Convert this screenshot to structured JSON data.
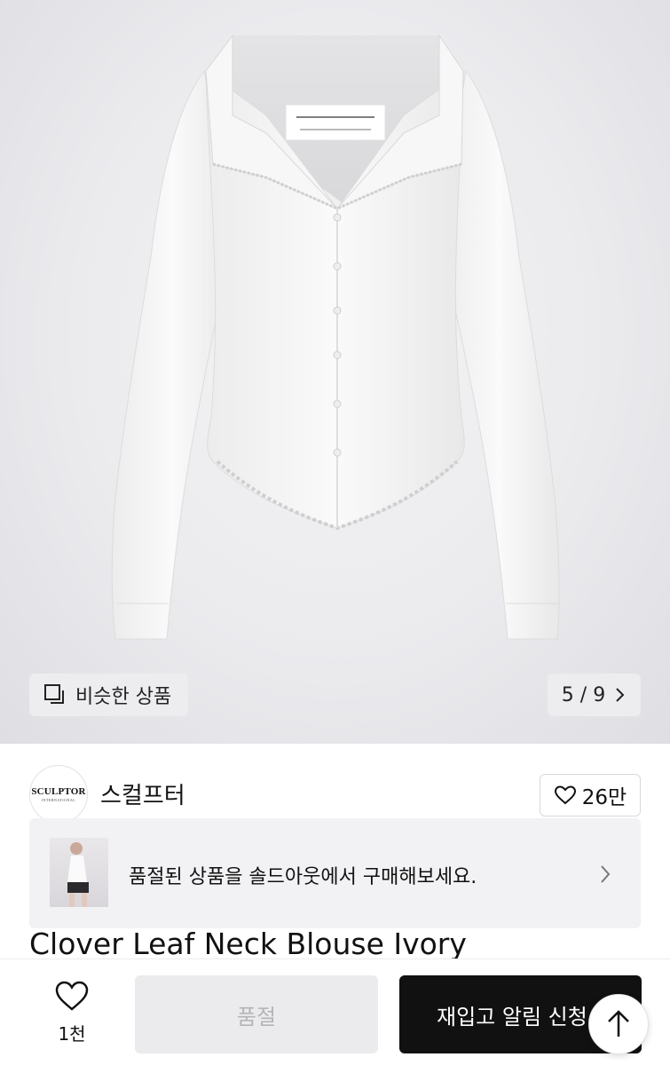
{
  "hero": {
    "similar_button": {
      "label": "비슷한 상품",
      "icon": "similar-items-icon"
    },
    "pager": {
      "current": "5",
      "separator": "/",
      "total": "9",
      "text": "5 / 9",
      "icon": "chevron-right-icon"
    }
  },
  "seller": {
    "name": "스컬프터",
    "logo_text": "SCULPTOR",
    "logo_subtext": "INTERNATIONAL",
    "likes": "26만",
    "like_icon": "heart-outline-icon"
  },
  "banner": {
    "text": "품절된 상품을 솔드아웃에서 구매해보세요.",
    "icon": "chevron-right-icon"
  },
  "product": {
    "title": "Clover Leaf Neck Blouse Ivory"
  },
  "bottom_bar": {
    "wish_count": "1천",
    "wish_icon": "heart-outline-icon",
    "soldout_label": "품절",
    "restock_label": "재입고 알림 신청",
    "scroll_top_icon": "arrow-up-icon"
  },
  "colors": {
    "primary_button": "#111111",
    "disabled_button": "#ebebed",
    "banner_bg": "#f2f2f4"
  }
}
